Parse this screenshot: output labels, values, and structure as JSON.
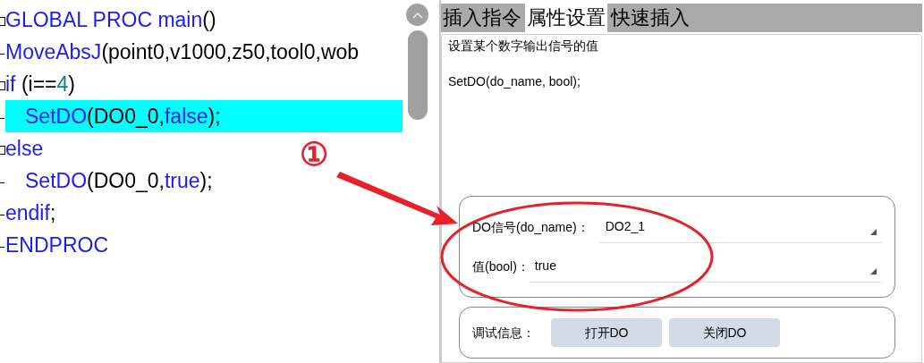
{
  "code_lines": [
    {
      "fold": true,
      "highlighted": false,
      "tokens": [
        {
          "kind": "keyword",
          "text": "GLOBAL PROC main"
        },
        {
          "kind": "plain",
          "text": "()"
        }
      ]
    },
    {
      "fold": false,
      "highlighted": false,
      "tokens": [
        {
          "kind": "keyword",
          "text": "MoveAbsJ"
        },
        {
          "kind": "plain",
          "text": "(point0,v1000,z50,tool0,wob"
        }
      ]
    },
    {
      "fold": true,
      "highlighted": false,
      "tokens": [
        {
          "kind": "keyword",
          "text": "if"
        },
        {
          "kind": "plain",
          "text": " (i=="
        },
        {
          "kind": "number",
          "text": "4"
        },
        {
          "kind": "plain",
          "text": ")"
        }
      ],
      "children": [
        {
          "fold": false,
          "highlighted": true,
          "tokens": [
            {
              "kind": "keyword",
              "text": "SetDO"
            },
            {
              "kind": "plain",
              "text": "(DO0_0,"
            },
            {
              "kind": "keyword",
              "text": "false"
            },
            {
              "kind": "plain",
              "text": ");"
            }
          ]
        }
      ]
    },
    {
      "fold": true,
      "highlighted": false,
      "tokens": [
        {
          "kind": "keyword",
          "text": "else"
        }
      ],
      "children": [
        {
          "fold": false,
          "highlighted": false,
          "tokens": [
            {
              "kind": "keyword",
              "text": "SetDO"
            },
            {
              "kind": "plain",
              "text": "(DO0_0,"
            },
            {
              "kind": "keyword",
              "text": "true"
            },
            {
              "kind": "plain",
              "text": ");"
            }
          ]
        }
      ]
    },
    {
      "fold": false,
      "highlighted": false,
      "tokens": [
        {
          "kind": "keyword",
          "text": "endif"
        },
        {
          "kind": "plain",
          "text": ";"
        }
      ]
    },
    {
      "fold": false,
      "highlighted": false,
      "tokens": [
        {
          "kind": "keyword",
          "text": "ENDPROC"
        }
      ]
    }
  ],
  "tabs": [
    {
      "label": "插入指令",
      "selected": false
    },
    {
      "label": "属性设置",
      "selected": true
    },
    {
      "label": "快速插入",
      "selected": false
    }
  ],
  "description": {
    "summary": "设置某个数字输出信号的值",
    "syntax": "SetDO(do_name, bool);"
  },
  "parameters": [
    {
      "label": "DO信号(do_name)：",
      "value": "DO2_1"
    },
    {
      "label": "值(bool)：",
      "value": "true"
    }
  ],
  "debug": {
    "label": "调试信息：",
    "buttons": [
      "打开DO",
      "关闭DO"
    ]
  },
  "annotation": {
    "marker": "①"
  }
}
